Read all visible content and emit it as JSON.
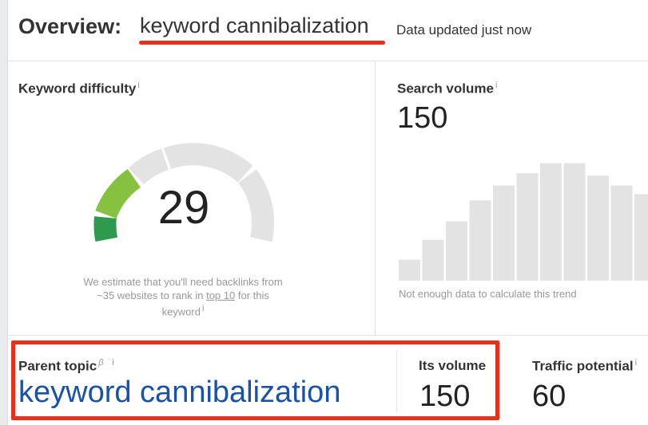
{
  "header": {
    "overview_label": "Overview:",
    "keyword": "keyword cannibalization",
    "updated_text": "Data updated just now",
    "underline_color": "#e8301c"
  },
  "keyword_difficulty": {
    "title": "Keyword difficulty",
    "info": "i",
    "value": "29",
    "gauge_level": 0.29,
    "note_before": "We estimate that you'll need backlinks from ~35 websites to rank in",
    "note_link": "top 10",
    "note_after": "for this keyword",
    "note_info": "i",
    "colors": {
      "filled_dark": "#2e9a4e",
      "filled_light": "#86c13f",
      "track": "#e3e3e3"
    }
  },
  "search_volume": {
    "title": "Search volume",
    "info": "i",
    "value": "150",
    "trend_relative_heights": [
      0.17,
      0.33,
      0.48,
      0.65,
      0.77,
      0.87,
      0.95,
      0.95,
      0.85,
      0.77,
      0.7
    ],
    "note": "Not enough data to calculate this trend",
    "bar_color": "#e3e3e3"
  },
  "parent_topic": {
    "title": "Parent topic",
    "beta": "β",
    "info": "i",
    "value": "keyword cannibalization",
    "highlight_color": "#e8301c"
  },
  "its_volume": {
    "title": "Its volume",
    "value": "150"
  },
  "traffic_potential": {
    "title": "Traffic potential",
    "info": "i",
    "value": "60"
  }
}
